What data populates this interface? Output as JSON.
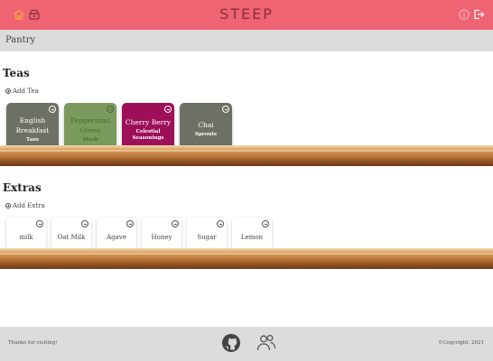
{
  "app": {
    "title": "STEEP"
  },
  "header": {
    "icons": [
      "home-icon",
      "inventory-icon",
      "info-icon",
      "logout-icon"
    ]
  },
  "page": {
    "title": "Pantry"
  },
  "teas": {
    "heading": "Teas",
    "add_label": "Add Tea",
    "items": [
      {
        "name": "English Breakfast",
        "brand": "Tazo",
        "color": "#6d7165"
      },
      {
        "name": "Peppermint Green",
        "brand": "Stash",
        "color": "#7a9b5d"
      },
      {
        "name": "Cherry Berry",
        "brand": "Celestial Seasonings",
        "color": "#9e0f5a"
      },
      {
        "name": "Chai",
        "brand": "Sprouts",
        "color": "#6d7165"
      }
    ]
  },
  "extras": {
    "heading": "Extras",
    "add_label": "Add Extra",
    "items": [
      "milk",
      "Oat Milk",
      "Agave",
      "Honey",
      "Sugar",
      "Lemon"
    ]
  },
  "footer": {
    "thanks": "Thanks for visiting!",
    "copyright": "©Copyright, 2021",
    "icons": [
      "github-icon",
      "team-icon"
    ]
  },
  "colors": {
    "accent": "#ee6473",
    "brand_text": "#8c2e3b",
    "home_icon": "#f6a63c",
    "bar": "#dcdcdc"
  }
}
